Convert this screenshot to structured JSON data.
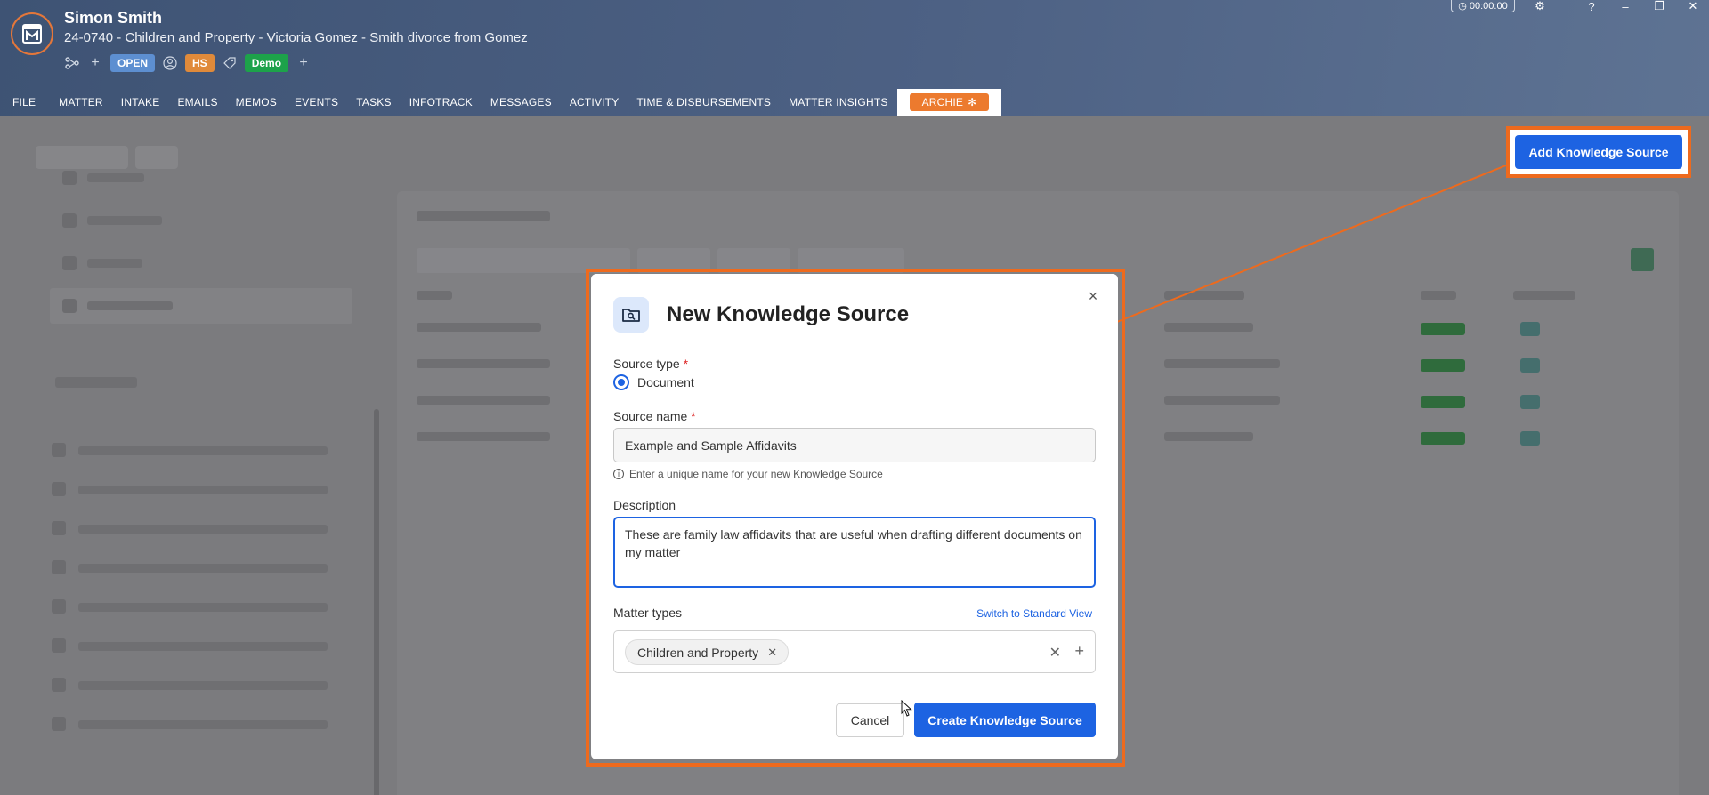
{
  "header": {
    "client_name": "Simon Smith",
    "matter_line": "24-0740 - Children and Property - Victoria Gomez - Smith divorce from Gomez",
    "status_chip": "OPEN",
    "initials_chip": "HS",
    "tag_chip": "Demo",
    "timer": "00:00:00"
  },
  "nav": {
    "tabs": [
      "FILE",
      "MATTER",
      "INTAKE",
      "EMAILS",
      "MEMOS",
      "EVENTS",
      "TASKS",
      "INFOTRACK",
      "MESSAGES",
      "ACTIVITY",
      "TIME & DISBURSEMENTS",
      "MATTER INSIGHTS"
    ],
    "active_tab": "ARCHIE"
  },
  "toolbar": {
    "add_knowledge_source": "Add Knowledge Source"
  },
  "modal": {
    "title": "New Knowledge Source",
    "source_type_label": "Source type",
    "required_mark": "*",
    "source_type_option": "Document",
    "source_name_label": "Source name",
    "source_name_value": "Example and Sample Affidavits",
    "source_name_hint": "Enter a unique name for your new Knowledge Source",
    "description_label": "Description",
    "description_value": "These are family law affidavits that are useful when drafting different documents on my matter",
    "matter_types_label": "Matter types",
    "switch_view_link": "Switch to Standard View",
    "matter_type_tag": "Children and Property",
    "cancel_label": "Cancel",
    "create_label": "Create Knowledge Source"
  },
  "colors": {
    "accent": "#1d63e2",
    "highlight": "#ee6a1d",
    "header_bg": "#4d6184",
    "archie": "#ec7a2e"
  },
  "icons": [
    "matter-logo-icon",
    "relationship-icon",
    "add-icon",
    "person-icon",
    "tag-icon",
    "clock-icon",
    "gear-icon",
    "help-icon",
    "minimize-icon",
    "restore-icon",
    "sparkle-icon",
    "folder-search-icon",
    "close-icon",
    "info-icon",
    "remove-tag-icon",
    "clear-icon"
  ]
}
